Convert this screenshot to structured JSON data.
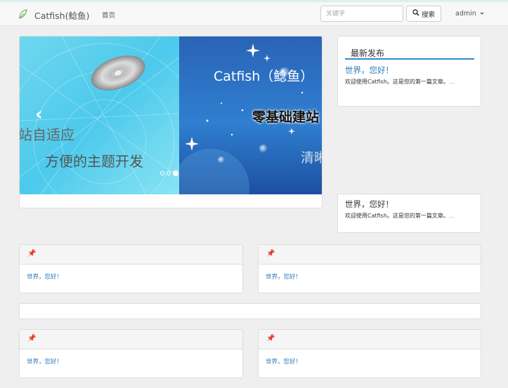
{
  "navbar": {
    "brand": "Catfish(鲶鱼)",
    "home": "首页",
    "search_placeholder": "关键字",
    "search_button": "搜索",
    "user": "admin"
  },
  "carousel": {
    "slide1_line1": "站自适应",
    "slide1_line2": "方便的主题开发",
    "slide2_title": "Catfish（鲶鱼）",
    "slide2_sub": "零基础建站",
    "slide2_text": "清晰",
    "active_index": 2,
    "indicator_count": 3
  },
  "latest": {
    "title": "最新发布",
    "post_title": "世界，您好！",
    "post_excerpt": "欢迎使用Catfish。这是您的第一篇文章。",
    "more": "..."
  },
  "post": {
    "title": "世界，您好！",
    "excerpt": "欢迎使用Catfish。这是您的第一篇文章。",
    "more": "..."
  },
  "grid": [
    {
      "link": "世界，您好！"
    },
    {
      "link": "世界，您好！"
    },
    {
      "link": "世界，您好！"
    },
    {
      "link": "世界，您好！"
    }
  ],
  "colors": {
    "accent": "#2a8bd0",
    "link": "#2a79bd"
  }
}
